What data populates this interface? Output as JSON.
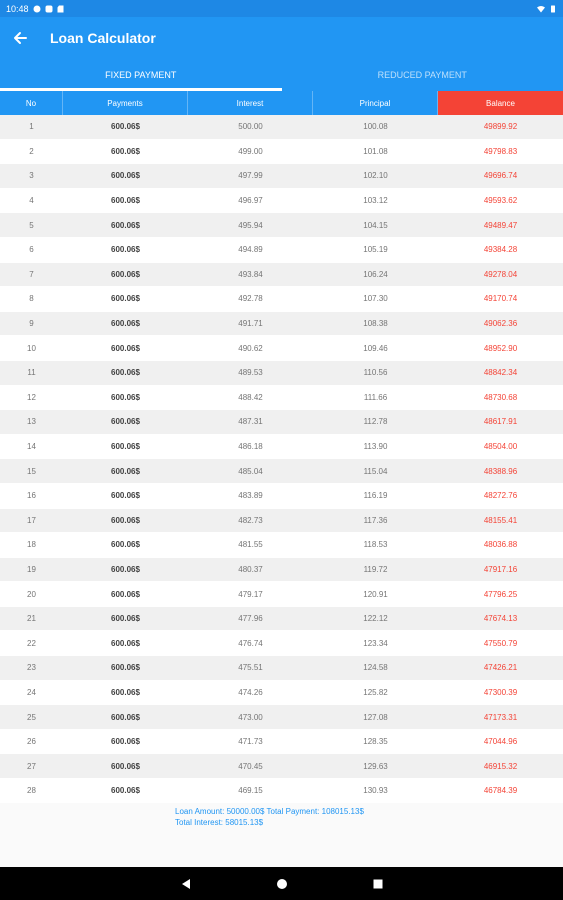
{
  "status_bar": {
    "time": "10:48"
  },
  "app_bar": {
    "title": "Loan Calculator",
    "back_icon": "arrow-left-icon"
  },
  "tabs": [
    {
      "label": "FIXED PAYMENT",
      "active": true
    },
    {
      "label": "REDUCED PAYMENT",
      "active": false
    }
  ],
  "table": {
    "headers": [
      "No",
      "Payments",
      "Interest",
      "Principal",
      "Balance"
    ],
    "rows": [
      [
        "1",
        "600.06$",
        "500.00",
        "100.08",
        "49899.92"
      ],
      [
        "2",
        "600.06$",
        "499.00",
        "101.08",
        "49798.83"
      ],
      [
        "3",
        "600.06$",
        "497.99",
        "102.10",
        "49696.74"
      ],
      [
        "4",
        "600.06$",
        "496.97",
        "103.12",
        "49593.62"
      ],
      [
        "5",
        "600.06$",
        "495.94",
        "104.15",
        "49489.47"
      ],
      [
        "6",
        "600.06$",
        "494.89",
        "105.19",
        "49384.28"
      ],
      [
        "7",
        "600.06$",
        "493.84",
        "106.24",
        "49278.04"
      ],
      [
        "8",
        "600.06$",
        "492.78",
        "107.30",
        "49170.74"
      ],
      [
        "9",
        "600.06$",
        "491.71",
        "108.38",
        "49062.36"
      ],
      [
        "10",
        "600.06$",
        "490.62",
        "109.46",
        "48952.90"
      ],
      [
        "11",
        "600.06$",
        "489.53",
        "110.56",
        "48842.34"
      ],
      [
        "12",
        "600.06$",
        "488.42",
        "111.66",
        "48730.68"
      ],
      [
        "13",
        "600.06$",
        "487.31",
        "112.78",
        "48617.91"
      ],
      [
        "14",
        "600.06$",
        "486.18",
        "113.90",
        "48504.00"
      ],
      [
        "15",
        "600.06$",
        "485.04",
        "115.04",
        "48388.96"
      ],
      [
        "16",
        "600.06$",
        "483.89",
        "116.19",
        "48272.76"
      ],
      [
        "17",
        "600.06$",
        "482.73",
        "117.36",
        "48155.41"
      ],
      [
        "18",
        "600.06$",
        "481.55",
        "118.53",
        "48036.88"
      ],
      [
        "19",
        "600.06$",
        "480.37",
        "119.72",
        "47917.16"
      ],
      [
        "20",
        "600.06$",
        "479.17",
        "120.91",
        "47796.25"
      ],
      [
        "21",
        "600.06$",
        "477.96",
        "122.12",
        "47674.13"
      ],
      [
        "22",
        "600.06$",
        "476.74",
        "123.34",
        "47550.79"
      ],
      [
        "23",
        "600.06$",
        "475.51",
        "124.58",
        "47426.21"
      ],
      [
        "24",
        "600.06$",
        "474.26",
        "125.82",
        "47300.39"
      ],
      [
        "25",
        "600.06$",
        "473.00",
        "127.08",
        "47173.31"
      ],
      [
        "26",
        "600.06$",
        "471.73",
        "128.35",
        "47044.96"
      ],
      [
        "27",
        "600.06$",
        "470.45",
        "129.63",
        "46915.32"
      ],
      [
        "28",
        "600.06$",
        "469.15",
        "130.93",
        "46784.39"
      ]
    ]
  },
  "summary": {
    "line1": "Loan Amount: 50000.00$ Total Payment: 108015.13$",
    "line2": "Total Interest: 58015.13$"
  },
  "nav_bar": {
    "back": "nav-back-icon",
    "home": "nav-home-icon",
    "recents": "nav-recents-icon"
  },
  "colors": {
    "primary": "#2196f3",
    "status": "#1e88e5",
    "accent": "#f44336"
  }
}
